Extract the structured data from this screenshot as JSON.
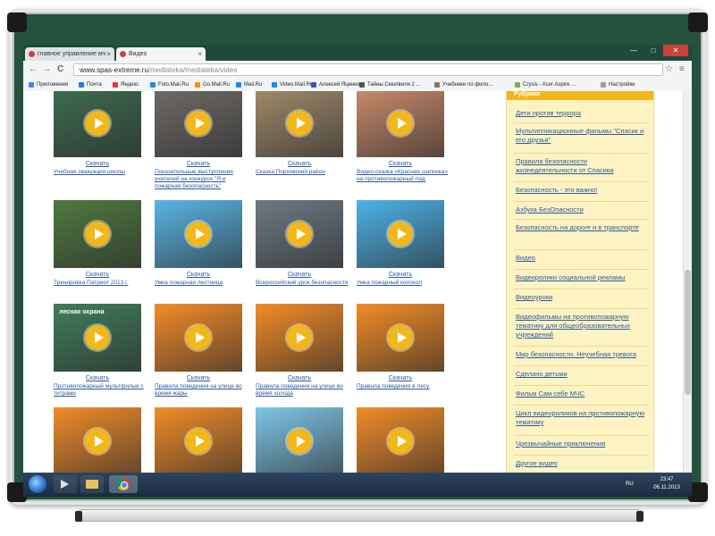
{
  "browser": {
    "tabs": [
      {
        "label": "главное управление мч",
        "active": false,
        "favicon_color": "#d23f3f"
      },
      {
        "label": "Видео",
        "active": true,
        "favicon_color": "#d23f3f"
      }
    ],
    "window_controls": [
      "—",
      "□",
      "✕"
    ],
    "nav": {
      "back": "←",
      "forward": "→",
      "reload": "C"
    },
    "url": {
      "host": "www.spas-extreme.ru",
      "path": "/mediateka/mediateka/video"
    },
    "star_icon": "☆",
    "menu_icon": "≡",
    "bookmarks": [
      {
        "label": "Приложения",
        "color": "#4285f4"
      },
      {
        "label": "Почта",
        "color": "#2a7ad5"
      },
      {
        "label": "Яндекс",
        "color": "#e53935"
      },
      {
        "label": "Foto.Mail.Ru",
        "color": "#1e88e5"
      },
      {
        "label": "Go.Mail.Ru",
        "color": "#fb8c00"
      },
      {
        "label": "Mail.Ru",
        "color": "#1e88e5"
      },
      {
        "label": "Video.Mail.Ru",
        "color": "#1e88e5"
      },
      {
        "label": "Алексей Яценко",
        "color": "#3f51b5"
      },
      {
        "label": "Тайны Смолвиля 2 ...",
        "color": "#555555"
      },
      {
        "label": "Учебники по фило...",
        "color": "#8d6e63"
      },
      {
        "label": "Crysis - Acer Aspire ...",
        "color": "#7cb342"
      },
      {
        "label": "Настройки",
        "color": "#9e9e9e"
      }
    ]
  },
  "videos": [
    {
      "caption": "Учебная эвакуация школы",
      "download": "Скачать",
      "bg": "#3d6b4f"
    },
    {
      "caption": "Показательные выступления учителей на конкурсе \"Я и пожарная безопасность\"",
      "download": "Скачать",
      "bg": "#6e6a66"
    },
    {
      "caption": "Сказка Порховский район",
      "download": "Скачать",
      "bg": "#a08a6a"
    },
    {
      "caption": "Видео-сказка «Красная шапочка» на противопожарный лад",
      "download": "Скачать",
      "bg": "#c98a6a"
    },
    {
      "caption": "Тренировка Патриот 2013 г.",
      "download": "Скачать",
      "bg": "#4f7a3e"
    },
    {
      "caption": "Умка пожарная лестница",
      "download": "Скачать",
      "bg": "#5ab5e6"
    },
    {
      "caption": "Всероссийский урок безопасности",
      "download": "Скачать",
      "bg": "#6d7a84"
    },
    {
      "caption": "Умка пожарный колокол",
      "download": "Скачать",
      "bg": "#4db3e8"
    },
    {
      "caption": "Противопожарный мультфильм с титрами",
      "download": "Скачать",
      "bg": "#3f7d5a",
      "overlay_text": "лесная охрана"
    },
    {
      "caption": "Правила поведения на улице во время жары",
      "download": "Скачать",
      "bg": "#f28c28"
    },
    {
      "caption": "Правила поведения на улице во время холода",
      "download": "Скачать",
      "bg": "#f28c28"
    },
    {
      "caption": "Правила поведения в лесу",
      "download": "Скачать",
      "bg": "#f28c28"
    },
    {
      "caption": "",
      "download": "",
      "bg": "#f28c28"
    },
    {
      "caption": "",
      "download": "",
      "bg": "#f28c28"
    },
    {
      "caption": "",
      "download": "",
      "bg": "#7fc6e8"
    },
    {
      "caption": "",
      "download": "",
      "bg": "#f28c28"
    }
  ],
  "sidebar": {
    "header": "Рубрики",
    "items": [
      "Дети против террора",
      "Мультипликационные фильмы \"Спасик и его друзья\"",
      "Правила безопасности жизнедеятельности от Спасика",
      "Безопасность - это важно!",
      "Азбука БезОпасности",
      "Безопасность на дороге и в транспорте",
      "Видео",
      "Видеоролики социальной рекламы",
      "Видеоуроки",
      "Видеофильмы на противопожарную тематику для общеобразовательных учреждений",
      "Мир безопасности. Неучебная тревога",
      "Сделано детьми",
      "Фильм Сам себе МЧС",
      "Цикл видеороликов на противопожарную тематику",
      "Чрезвычайные приключения",
      "Другое видео"
    ]
  },
  "taskbar": {
    "lang": "RU",
    "time": "23:47",
    "date": "06.11.2013"
  },
  "colors": {
    "board": "#25513f",
    "link": "#2c5aa0",
    "sidebar_bg": "#fdf3c2",
    "play": "#f2b81a"
  }
}
